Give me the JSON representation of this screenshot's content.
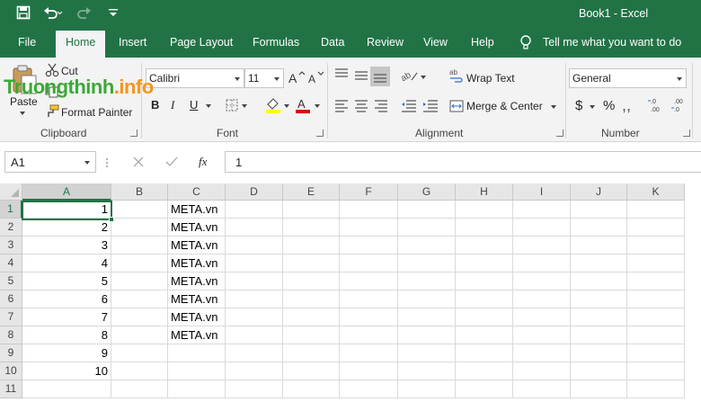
{
  "window": {
    "title": "Book1  -  Excel"
  },
  "tabs": [
    {
      "label": "File"
    },
    {
      "label": "Home"
    },
    {
      "label": "Insert"
    },
    {
      "label": "Page Layout"
    },
    {
      "label": "Formulas"
    },
    {
      "label": "Data"
    },
    {
      "label": "Review"
    },
    {
      "label": "View"
    },
    {
      "label": "Help"
    }
  ],
  "tell_me": "Tell me what you want to do",
  "clipboard": {
    "paste": "Paste",
    "cut": "Cut",
    "format_painter": "Format Painter",
    "label": "Clipboard"
  },
  "font": {
    "family": "Calibri",
    "size": "11",
    "bold": "B",
    "italic": "I",
    "underline": "U",
    "label": "Font"
  },
  "alignment": {
    "wrap_text": "Wrap Text",
    "merge_center": "Merge & Center",
    "label": "Alignment"
  },
  "number": {
    "format": "General",
    "currency": "$",
    "percent": "%",
    "label": "Number"
  },
  "formula_bar": {
    "name_box": "A1",
    "fx": "fx",
    "value": "1"
  },
  "columns": [
    "A",
    "B",
    "C",
    "D",
    "E",
    "F",
    "G",
    "H",
    "I",
    "J",
    "K"
  ],
  "rows": [
    {
      "n": "1",
      "a": "1",
      "c": "META.vn"
    },
    {
      "n": "2",
      "a": "2",
      "c": "META.vn"
    },
    {
      "n": "3",
      "a": "3",
      "c": "META.vn"
    },
    {
      "n": "4",
      "a": "4",
      "c": "META.vn"
    },
    {
      "n": "5",
      "a": "5",
      "c": "META.vn"
    },
    {
      "n": "6",
      "a": "6",
      "c": "META.vn"
    },
    {
      "n": "7",
      "a": "7",
      "c": "META.vn"
    },
    {
      "n": "8",
      "a": "8",
      "c": "META.vn"
    },
    {
      "n": "9",
      "a": "9",
      "c": ""
    },
    {
      "n": "10",
      "a": "10",
      "c": ""
    },
    {
      "n": "11",
      "a": "",
      "c": ""
    }
  ],
  "watermark": {
    "part1": "Truongthinh",
    "part2": ".info"
  },
  "colors": {
    "excel_green": "#217346",
    "ribbon_bg": "#f3f3f3",
    "watermark_green": "#3aaa35",
    "watermark_orange": "#f7941d"
  }
}
